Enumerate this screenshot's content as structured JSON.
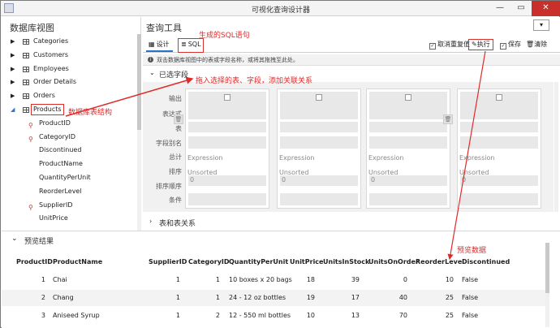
{
  "window": {
    "title": "可视化查询设计器",
    "min_label": "—",
    "max_label": "▭",
    "close_label": "✕"
  },
  "left_panel": {
    "title": "数据库视图",
    "tables": [
      {
        "label": "Categories",
        "expanded": false
      },
      {
        "label": "Customers",
        "expanded": false
      },
      {
        "label": "Employees",
        "expanded": false
      },
      {
        "label": "Order Details",
        "expanded": false
      },
      {
        "label": "Orders",
        "expanded": false
      },
      {
        "label": "Products",
        "expanded": true
      }
    ],
    "fields": [
      "ProductID",
      "CategoryID",
      "Discontinued",
      "ProductName",
      "QuantityPerUnit",
      "ReorderLevel",
      "SupplierID",
      "UnitPrice"
    ]
  },
  "query_tool": {
    "title": "查询工具",
    "dropdown_label": "▾",
    "tabs": {
      "design": "设计",
      "sql": "SQL"
    },
    "toolbar": {
      "dedupe_label": "取消重复值",
      "dedupe_checked": true,
      "run_label": "执行",
      "save_label": "保存",
      "clear_label": "清除"
    },
    "hint": "双击数据库视图中的表或字段名称，或将其拖拽至此处。",
    "selected_fields_label": "已选字段",
    "relations_label": "表和表关系",
    "prop_labels": [
      "输出",
      "表达式",
      "表",
      "字段别名",
      "总计",
      "排序",
      "排序顺序",
      "条件"
    ],
    "columns": [
      {
        "total": "Expression",
        "sort": "Unsorted",
        "order": "0"
      },
      {
        "total": "Expression",
        "sort": "Unsorted",
        "order": "0"
      },
      {
        "total": "Expression",
        "sort": "Unsorted",
        "order": "0"
      },
      {
        "total": "Expression",
        "sort": "Unsorted",
        "order": "0"
      }
    ]
  },
  "results": {
    "title": "预览结果",
    "headers": [
      "ProductID",
      "ProductName",
      "SupplierID",
      "CategoryID",
      "QuantityPerUnit",
      "UnitPrice",
      "UnitsInStock",
      "UnitsOnOrder",
      "ReorderLevel",
      "Discontinued"
    ],
    "rows": [
      [
        "1",
        "Chai",
        "1",
        "1",
        "10 boxes x 20 bags",
        "18",
        "39",
        "0",
        "10",
        "False"
      ],
      [
        "2",
        "Chang",
        "1",
        "1",
        "24 - 12 oz bottles",
        "19",
        "17",
        "40",
        "25",
        "False"
      ],
      [
        "3",
        "Aniseed Syrup",
        "1",
        "2",
        "12 - 550 ml bottles",
        "10",
        "13",
        "70",
        "25",
        "False"
      ]
    ]
  },
  "annotations": {
    "sql": "生成的SQL语句",
    "drag": "拖入选择的表、字段，添加关联关系",
    "structure": "数据库表结构",
    "preview": "预览数据"
  },
  "colors": {
    "annotation": "#e02a2a",
    "accent": "#2a73c7"
  }
}
